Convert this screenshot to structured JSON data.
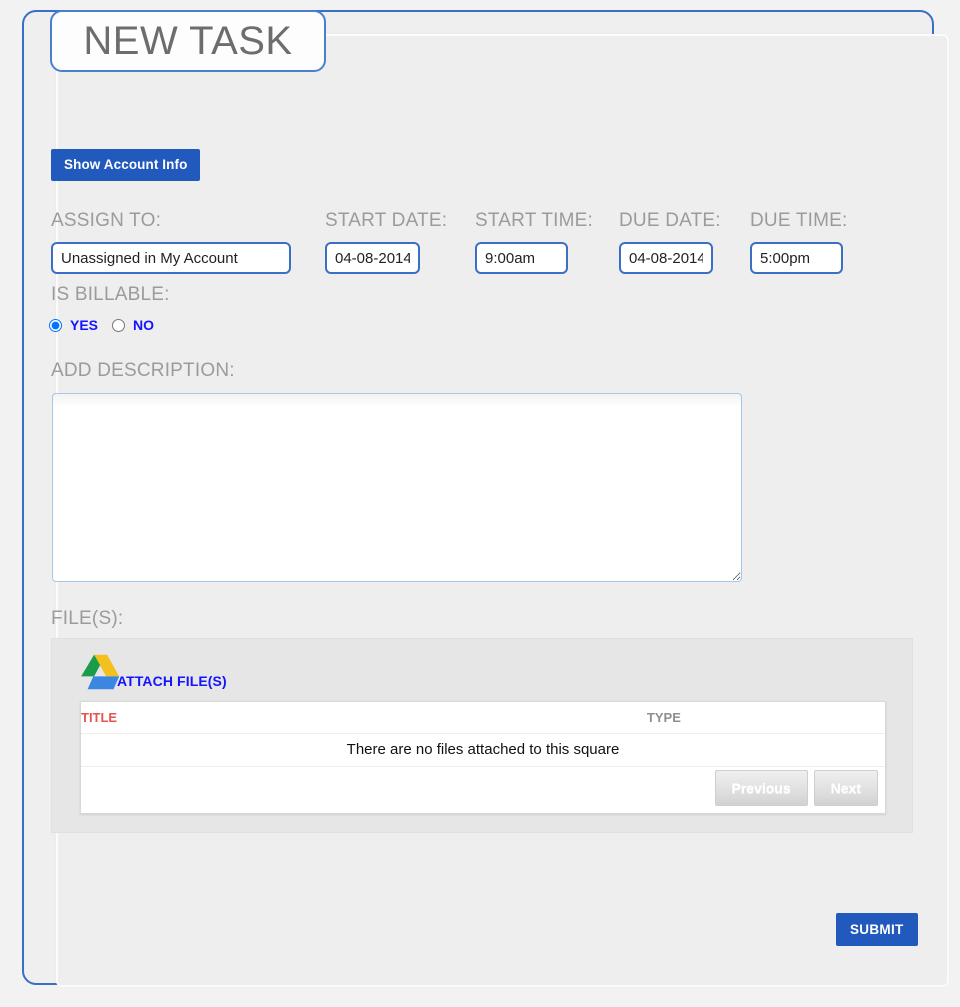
{
  "page": {
    "title": "NEW TASK"
  },
  "toolbar": {
    "show_account_info_label": "Show Account Info"
  },
  "form": {
    "assign_to": {
      "label": "ASSIGN TO:",
      "value": "Unassigned in My Account",
      "placeholder": ""
    },
    "start_date": {
      "label": "START DATE:",
      "value": "04-08-2014",
      "placeholder": ""
    },
    "start_time": {
      "label": "START TIME:",
      "value": "9:00am",
      "placeholder": ""
    },
    "due_date": {
      "label": "DUE DATE:",
      "value": "04-08-2014",
      "placeholder": ""
    },
    "due_time": {
      "label": "DUE TIME:",
      "value": "5:00pm",
      "placeholder": ""
    },
    "is_billable": {
      "label": "IS BILLABLE:",
      "yes_label": "YES",
      "no_label": "NO",
      "selected": "YES"
    },
    "description": {
      "label": "ADD DESCRIPTION:",
      "value": "",
      "placeholder": ""
    }
  },
  "files": {
    "label": "FILE(S):",
    "attach_link_label": "ATTACH FILE(S)",
    "attach_icon": "google-drive-icon",
    "table": {
      "columns": [
        "TITLE",
        "TYPE"
      ],
      "rows": [],
      "empty_message": "There are no files attached to this square"
    },
    "pager": {
      "previous_label": "Previous",
      "next_label": "Next"
    }
  },
  "actions": {
    "submit_label": "SUBMIT"
  },
  "colors": {
    "accent_blue": "#2159bd",
    "frame_blue": "#3b6fc4",
    "link_blue": "#1414ff",
    "label_gray": "#9b9b9b",
    "title_red": "#e7534f",
    "page_bg": "#f2f2f2",
    "panel_bg": "#eeeeee",
    "files_panel_bg": "#e6e6e6"
  }
}
